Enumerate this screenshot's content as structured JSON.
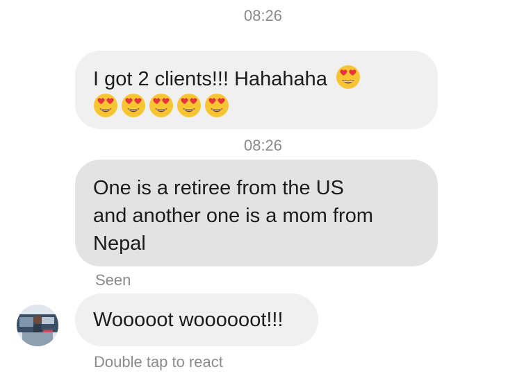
{
  "conversation": {
    "timestamp_1": "08:26",
    "message_1": {
      "text_line_1": "I got 2 clients!!! Hahahaha",
      "emoji": "heart-eyes-emoji"
    },
    "timestamp_2": "08:26",
    "message_2": {
      "lines": [
        "One is a retiree from the US",
        "and another one is a mom from",
        "Nepal"
      ]
    },
    "seen_label": "Seen",
    "message_3": {
      "text": "Wooooot woooooot!!!"
    },
    "react_hint": "Double tap to react"
  },
  "colors": {
    "bubble_light": "#f0f0f0",
    "bubble_gray": "#e3e3e3",
    "meta_text": "#8a8a8a",
    "emoji_face": "#f7c531",
    "emoji_heart": "#e8323c"
  }
}
